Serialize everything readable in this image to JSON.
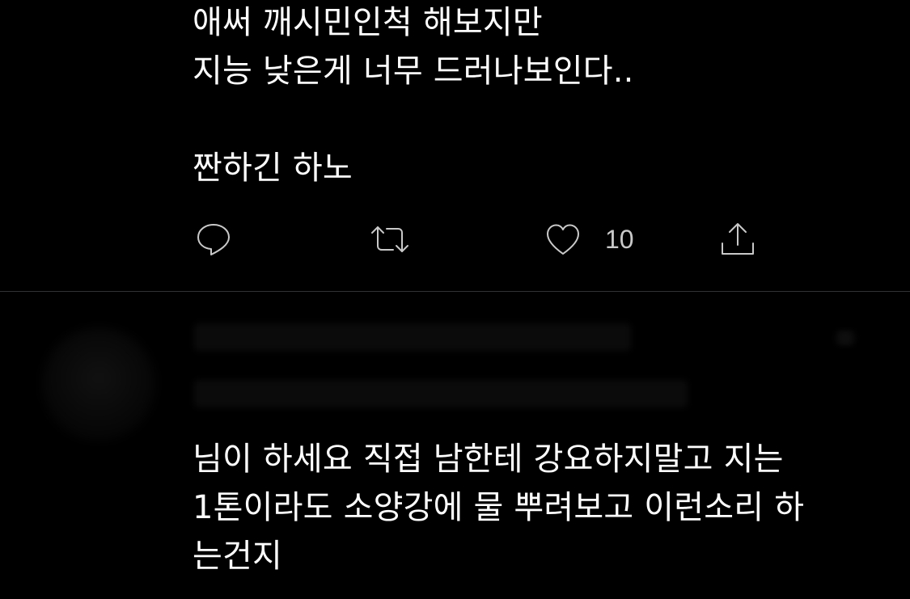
{
  "tweet1": {
    "text": "애써 깨시민인척 해보지만\n지능 낮은게 너무 드러나보인다..\n\n짠하긴 하노",
    "actions": {
      "reply_icon": "reply-icon",
      "retweet_icon": "retweet-icon",
      "like_icon": "heart-icon",
      "like_count": "10",
      "share_icon": "share-icon"
    }
  },
  "tweet2": {
    "text": "님이 하세요 직접 남한테 강요하지말고 지는\n1톤이라도 소양강에 물 뿌려보고 이런소리 하\n는건지"
  },
  "colors": {
    "background": "#000000",
    "text": "#ffffff",
    "icon": "#c9c9c9",
    "divider": "#2f3336"
  }
}
